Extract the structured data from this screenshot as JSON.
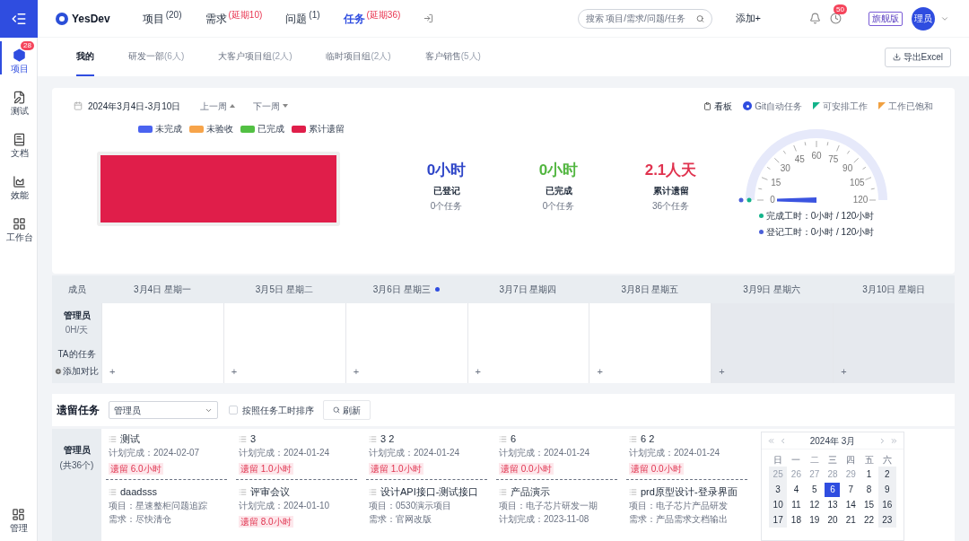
{
  "sidebar": {
    "items": [
      {
        "label": "项目",
        "badge": "28",
        "selected": true,
        "kind": "project"
      },
      {
        "label": "测试",
        "selected": false,
        "kind": "test"
      },
      {
        "label": "文档",
        "selected": false,
        "kind": "doc"
      },
      {
        "label": "效能",
        "selected": false,
        "kind": "stats"
      },
      {
        "label": "工作台",
        "selected": false,
        "kind": "desk"
      }
    ],
    "bottom": {
      "label": "管理",
      "kind": "admin"
    }
  },
  "topbar": {
    "logo": "YesDev",
    "nav": [
      {
        "label": "项目",
        "count": "(20)",
        "selected": false,
        "alert": false
      },
      {
        "label": "需求",
        "count": "(延期10)",
        "selected": false,
        "alert": true
      },
      {
        "label": "问题",
        "count": "(1)",
        "selected": false,
        "alert": false
      },
      {
        "label": "任务",
        "count": "(延期36)",
        "selected": true,
        "alert": true
      }
    ],
    "search_placeholder": "搜索 项目/需求/问题/任务",
    "add": "添加+",
    "clock_badge": "50",
    "edition": "旗舰版",
    "avatar": "理员"
  },
  "tabs": [
    {
      "label": "我的",
      "selected": true
    },
    {
      "label": "研发一部",
      "count": "(6人)",
      "selected": false
    },
    {
      "label": "大客户项目组",
      "count": "(2人)",
      "selected": false
    },
    {
      "label": "临时项目组",
      "count": "(2人)",
      "selected": false
    },
    {
      "label": "客户销售",
      "count": "(5人)",
      "selected": false
    }
  ],
  "export": "导出Excel",
  "summary": {
    "date_range": "2024年3月4日-3月10日",
    "prev": "上一周",
    "next": "下一周",
    "options": [
      {
        "label": "看板",
        "kind": "board"
      },
      {
        "label": "Git自动任务",
        "kind": "radio"
      },
      {
        "label": "可安排工作",
        "kind": "flag",
        "color": "#13b38a"
      },
      {
        "label": "工作已饱和",
        "kind": "flag",
        "color": "#f0a040"
      }
    ],
    "legend": [
      {
        "label": "未完成",
        "color": "#4a63f0"
      },
      {
        "label": "未验收",
        "color": "#f7a44a"
      },
      {
        "label": "已完成",
        "color": "#52c043"
      },
      {
        "label": "累计遗留",
        "color": "#e01e4a"
      }
    ],
    "stats": [
      {
        "value": "0小时",
        "label": "已登记",
        "sub": "0个任务",
        "color": "#2f46c8"
      },
      {
        "value": "0小时",
        "label": "已完成",
        "sub": "0个任务",
        "color": "#52b640"
      },
      {
        "value": "2.1人天",
        "label": "累计遗留",
        "sub": "36个任务",
        "color": "#e0334f"
      }
    ],
    "gauge": {
      "ticks": [
        "0",
        "15",
        "30",
        "45",
        "60",
        "75",
        "90",
        "105",
        "120"
      ],
      "legend": [
        {
          "label": "完成工时：0小时 / 120小时",
          "color": "#13b38a"
        },
        {
          "label": "登记工时：0小时 / 120小时",
          "color": "#4a5fd8"
        }
      ]
    }
  },
  "week": {
    "member_header": "成员",
    "days": [
      {
        "label": "3月4日 星期一",
        "today": false,
        "weekend": false
      },
      {
        "label": "3月5日 星期二",
        "today": false,
        "weekend": false
      },
      {
        "label": "3月6日 星期三",
        "today": true,
        "weekend": false
      },
      {
        "label": "3月7日 星期四",
        "today": false,
        "weekend": false
      },
      {
        "label": "3月8日 星期五",
        "today": false,
        "weekend": false
      },
      {
        "label": "3月9日 星期六",
        "today": false,
        "weekend": true
      },
      {
        "label": "3月10日 星期日",
        "today": false,
        "weekend": true
      }
    ],
    "member": {
      "name": "管理员",
      "rate": "0H/天",
      "tasks": "TA的任务",
      "compare": "添加对比"
    },
    "add": "+"
  },
  "leftover": {
    "title": "遗留任务",
    "member_select": "管理员",
    "sort_label": "按照任务工时排序",
    "sort_checked": false,
    "refresh": "刷新",
    "member": {
      "name": "管理员",
      "count": "(共36个)"
    },
    "rows": [
      [
        {
          "title": "测试",
          "lines": [
            [
              "计划完成：",
              "2024-02-07"
            ]
          ],
          "left": "遗留 6.0小时"
        },
        {
          "title": "3",
          "lines": [
            [
              "计划完成：",
              "2024-01-24"
            ]
          ],
          "left": "遗留 1.0小时"
        },
        {
          "title": "3 2",
          "lines": [
            [
              "计划完成：",
              "2024-01-24"
            ]
          ],
          "left": "遗留 1.0小时"
        },
        {
          "title": "6",
          "lines": [
            [
              "计划完成：",
              "2024-01-24"
            ]
          ],
          "left": "遗留 0.0小时"
        },
        {
          "title": "6 2",
          "lines": [
            [
              "计划完成：",
              "2024-01-24"
            ]
          ],
          "left": "遗留 0.0小时"
        }
      ],
      [
        {
          "title": "daadsss",
          "lines": [
            [
              "项目：",
              "星速整柜问题追踪"
            ],
            [
              "需求：",
              "尽快清仓"
            ]
          ]
        },
        {
          "title": "评审会议",
          "lines": [
            [
              "计划完成：",
              "2024-01-10"
            ]
          ],
          "left": "遗留 8.0小时"
        },
        {
          "title": "设计API接口-测试接口",
          "lines": [
            [
              "项目：",
              "0530演示项目"
            ],
            [
              "需求：",
              "官网改版"
            ]
          ]
        },
        {
          "title": "产品演示",
          "lines": [
            [
              "项目：",
              "电子芯片研发一期"
            ],
            [
              "计划完成：",
              "2023-11-08"
            ]
          ]
        },
        {
          "title": "prd原型设计-登录界面",
          "lines": [
            [
              "项目：",
              "电子芯片产品研发"
            ],
            [
              "需求：",
              "产品需求文档输出"
            ]
          ]
        }
      ]
    ],
    "calendar": {
      "title": "2024年 3月",
      "weekdays": [
        "日",
        "一",
        "二",
        "三",
        "四",
        "五",
        "六"
      ],
      "weeks": [
        [
          {
            "d": "25",
            "muted": true,
            "selected": false
          },
          {
            "d": "26",
            "muted": true,
            "selected": false
          },
          {
            "d": "27",
            "muted": true,
            "selected": false
          },
          {
            "d": "28",
            "muted": true,
            "selected": false
          },
          {
            "d": "29",
            "muted": true,
            "selected": false
          },
          {
            "d": "1",
            "muted": false,
            "selected": false
          },
          {
            "d": "2",
            "muted": false,
            "selected": false
          }
        ],
        [
          {
            "d": "3",
            "muted": false,
            "selected": false
          },
          {
            "d": "4",
            "muted": false,
            "selected": false
          },
          {
            "d": "5",
            "muted": false,
            "selected": false
          },
          {
            "d": "6",
            "muted": false,
            "selected": true
          },
          {
            "d": "7",
            "muted": false,
            "selected": false
          },
          {
            "d": "8",
            "muted": false,
            "selected": false
          },
          {
            "d": "9",
            "muted": false,
            "selected": false
          }
        ],
        [
          {
            "d": "10",
            "muted": false,
            "selected": false
          },
          {
            "d": "11",
            "muted": false,
            "selected": false
          },
          {
            "d": "12",
            "muted": false,
            "selected": false
          },
          {
            "d": "13",
            "muted": false,
            "selected": false
          },
          {
            "d": "14",
            "muted": false,
            "selected": false
          },
          {
            "d": "15",
            "muted": false,
            "selected": false
          },
          {
            "d": "16",
            "muted": false,
            "selected": false
          }
        ],
        [
          {
            "d": "17",
            "muted": false,
            "selected": false
          },
          {
            "d": "18",
            "muted": false,
            "selected": false
          },
          {
            "d": "19",
            "muted": false,
            "selected": false
          },
          {
            "d": "20",
            "muted": false,
            "selected": false
          },
          {
            "d": "21",
            "muted": false,
            "selected": false
          },
          {
            "d": "22",
            "muted": false,
            "selected": false
          },
          {
            "d": "23",
            "muted": false,
            "selected": false
          }
        ]
      ]
    }
  }
}
